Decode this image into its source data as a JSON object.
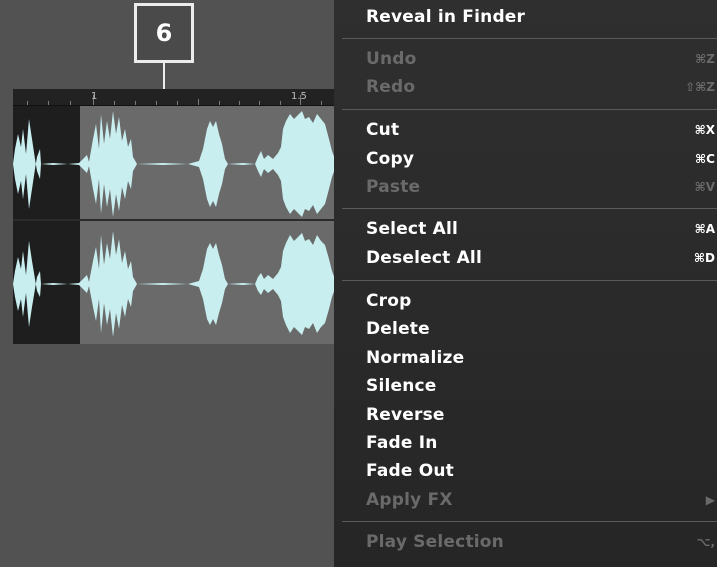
{
  "callout": {
    "number": "6"
  },
  "ruler": {
    "labels": [
      "1",
      "1.5"
    ]
  },
  "menu": {
    "items": [
      {
        "label": "Reveal in Finder",
        "shortcut": "",
        "enabled": true
      },
      {
        "label": "Undo",
        "shortcut": "⌘Z",
        "enabled": false
      },
      {
        "label": "Redo",
        "shortcut": "⇧⌘Z",
        "enabled": false
      },
      {
        "label": "Cut",
        "shortcut": "⌘X",
        "enabled": true
      },
      {
        "label": "Copy",
        "shortcut": "⌘C",
        "enabled": true
      },
      {
        "label": "Paste",
        "shortcut": "⌘V",
        "enabled": false
      },
      {
        "label": "Select All",
        "shortcut": "⌘A",
        "enabled": true
      },
      {
        "label": "Deselect All",
        "shortcut": "⌘D",
        "enabled": true
      },
      {
        "label": "Crop",
        "shortcut": "",
        "enabled": true
      },
      {
        "label": "Delete",
        "shortcut": "",
        "enabled": true
      },
      {
        "label": "Normalize",
        "shortcut": "",
        "enabled": true
      },
      {
        "label": "Silence",
        "shortcut": "",
        "enabled": true
      },
      {
        "label": "Reverse",
        "shortcut": "",
        "enabled": true
      },
      {
        "label": "Fade In",
        "shortcut": "",
        "enabled": true
      },
      {
        "label": "Fade Out",
        "shortcut": "",
        "enabled": true
      },
      {
        "label": "Apply FX",
        "shortcut": "",
        "enabled": false,
        "submenu_icon": "triangle-right-icon"
      },
      {
        "label": "Play Selection",
        "shortcut": "⌥,",
        "enabled": false
      }
    ]
  },
  "colors": {
    "waveform": "#c8eef0",
    "selection": "#6a6a6a",
    "menu_bg": "#2b2b2b",
    "disabled_text": "#6a6a6a"
  }
}
